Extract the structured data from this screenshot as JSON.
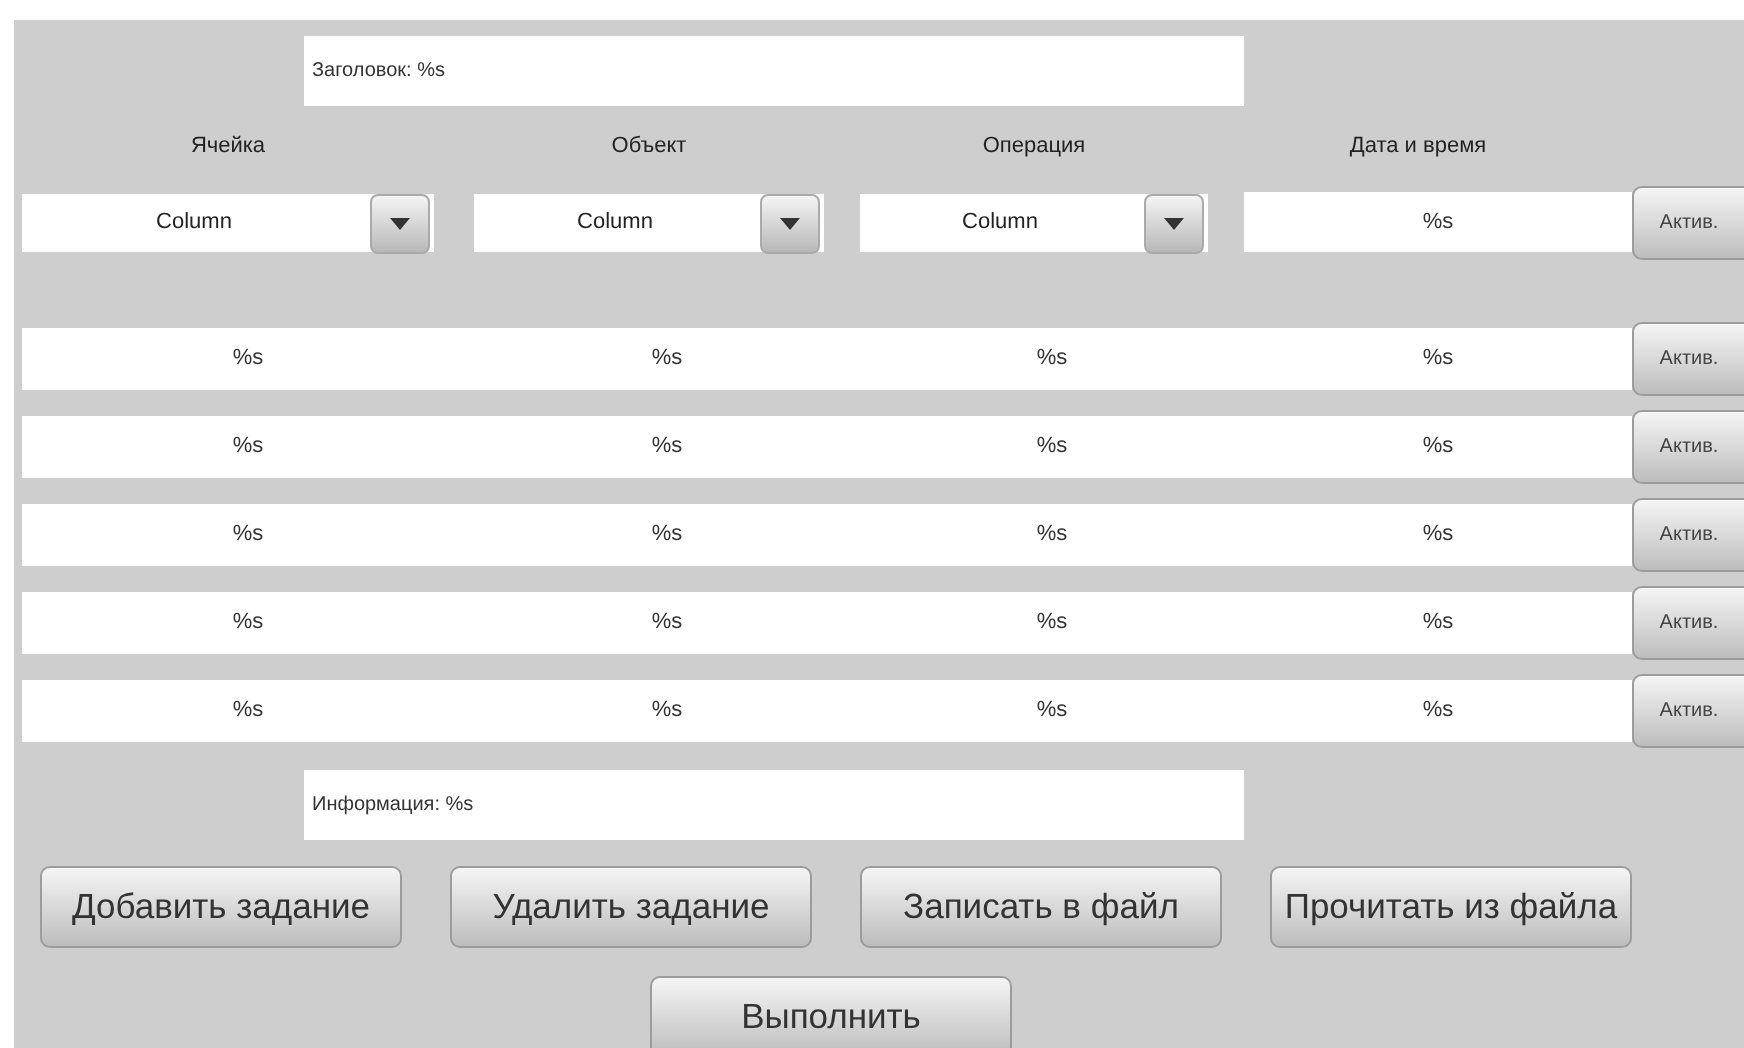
{
  "title_field": {
    "value": "Заголовок: %s"
  },
  "columns": [
    "Ячейка",
    "Объект",
    "Операция",
    "Дата и время"
  ],
  "header_row": {
    "dropdowns": [
      {
        "value": "Column"
      },
      {
        "value": "Column"
      },
      {
        "value": "Column"
      }
    ],
    "date_field": {
      "value": "%s"
    },
    "button": "Актив."
  },
  "rows": [
    {
      "cells": [
        "%s",
        "%s",
        "%s",
        "%s"
      ],
      "button": "Актив."
    },
    {
      "cells": [
        "%s",
        "%s",
        "%s",
        "%s"
      ],
      "button": "Актив."
    },
    {
      "cells": [
        "%s",
        "%s",
        "%s",
        "%s"
      ],
      "button": "Актив."
    },
    {
      "cells": [
        "%s",
        "%s",
        "%s",
        "%s"
      ],
      "button": "Актив."
    },
    {
      "cells": [
        "%s",
        "%s",
        "%s",
        "%s"
      ],
      "button": "Актив."
    }
  ],
  "info_field": {
    "value": "Информация: %s"
  },
  "actions": [
    "Добавить задание",
    "Удалить задание",
    "Записать в файл",
    "Прочитать из файла"
  ],
  "execute_button": "Выполнить"
}
